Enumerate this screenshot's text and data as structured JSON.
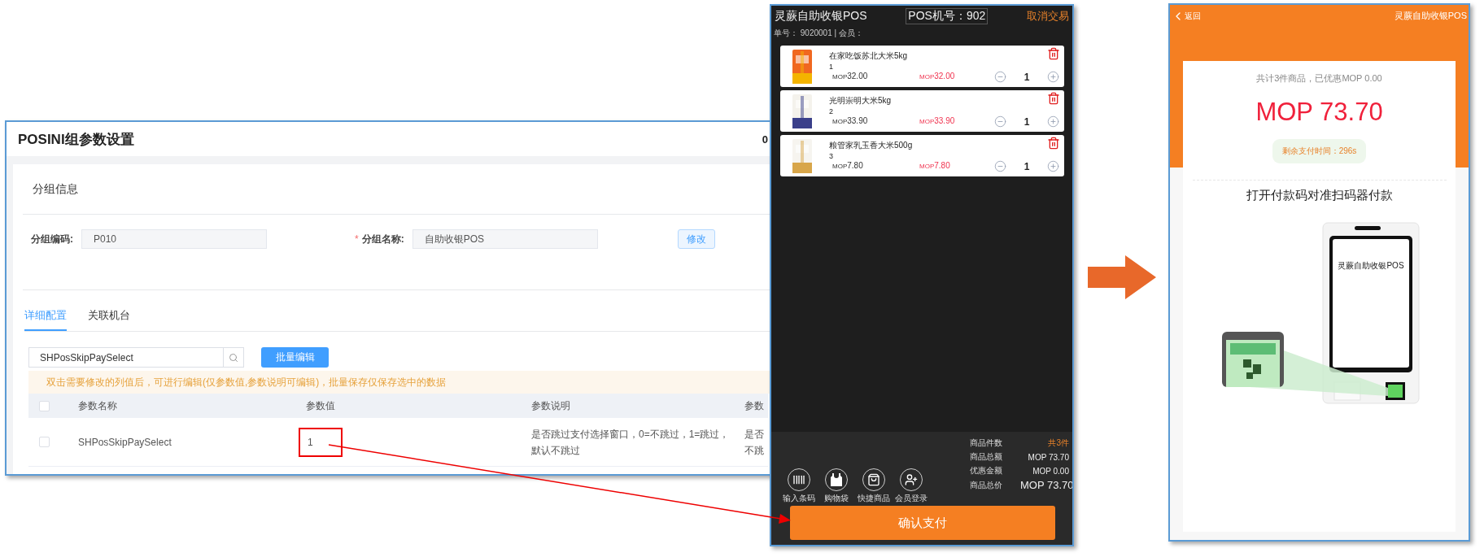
{
  "admin": {
    "title": "POSINI组参数设置",
    "header_cut": "0",
    "section_title": "分组信息",
    "required_mark": "*",
    "fields": [
      {
        "label": "分组编码:",
        "value": "P010",
        "required": false
      },
      {
        "label": "分组名称:",
        "value": "自助收银POS",
        "required": true
      }
    ],
    "edit_button": "修改",
    "tabs": [
      {
        "label": "详细配置",
        "selected": true
      },
      {
        "label": "关联机台",
        "selected": false
      }
    ],
    "search": {
      "value": "SHPosSkipPaySelect"
    },
    "batch_button": "批量编辑",
    "notice": "双击需要修改的列值后，可进行编辑(仅参数值,参数说明可编辑)，批量保存仅保存选中的数据",
    "table": {
      "header_checked": false,
      "columns": [
        "参数名称",
        "参数值",
        "参数说明",
        "参数"
      ],
      "rows": [
        {
          "checked": false,
          "cells": [
            {
              "text": "SHPosSkipPaySelect",
              "highlighted": false
            },
            {
              "text": "1",
              "highlighted": true
            },
            {
              "text": "是否跳过支付选择窗口，0=不跳过，1=跳过，默认不跳过",
              "highlighted": false
            },
            {
              "text": "是否不跳",
              "highlighted": false
            }
          ]
        }
      ]
    }
  },
  "pos": {
    "title": "灵蕨自助收银POS",
    "terminal": "POS机号：902",
    "cancel": "取消交易",
    "order_info": "单号： 9020001 | 会员：",
    "items": [
      {
        "name": "在家吃饭苏北大米5kg",
        "index": "1",
        "unit_price": "$_{MOP}$32.00",
        "total": "$_{MOP}$32.00",
        "qty": "1"
      },
      {
        "name": "光明崇明大米5kg",
        "index": "2",
        "unit_price": "$_{MOP}$33.90",
        "total": "$_{MOP}$33.90",
        "qty": "1"
      },
      {
        "name": "粮管家乳玉香大米500g",
        "index": "3",
        "unit_price": "$_{MOP}$7.80",
        "total": "$_{MOP}$7.80",
        "qty": "1"
      }
    ],
    "actions": [
      {
        "kind": "barcode",
        "label": "输入条码"
      },
      {
        "kind": "bag",
        "label": "购物袋"
      },
      {
        "kind": "quick",
        "label": "快捷商品"
      },
      {
        "kind": "member",
        "label": "会员登录"
      }
    ],
    "summary": [
      {
        "kind": "count",
        "label": "商品件数",
        "value": "共3件"
      },
      {
        "kind": "normal",
        "label": "商品总额",
        "value": "MOP 73.70"
      },
      {
        "kind": "normal",
        "label": "优惠金额",
        "value": "MOP 0.00"
      },
      {
        "kind": "total",
        "label": "商品总价",
        "value": "MOP 73.70"
      }
    ],
    "confirm_button": "确认支付"
  },
  "phone": {
    "back": "返回",
    "title": "灵蕨自助收银POS",
    "summary": "共计3件商品，已优惠MOP 0.00",
    "amount": "MOP 73.70",
    "timer": "剩余支付时间：296s",
    "instruction": "打开付款码对准扫码器付款",
    "kiosk_screen_text": "灵蕨自助收银POS"
  }
}
